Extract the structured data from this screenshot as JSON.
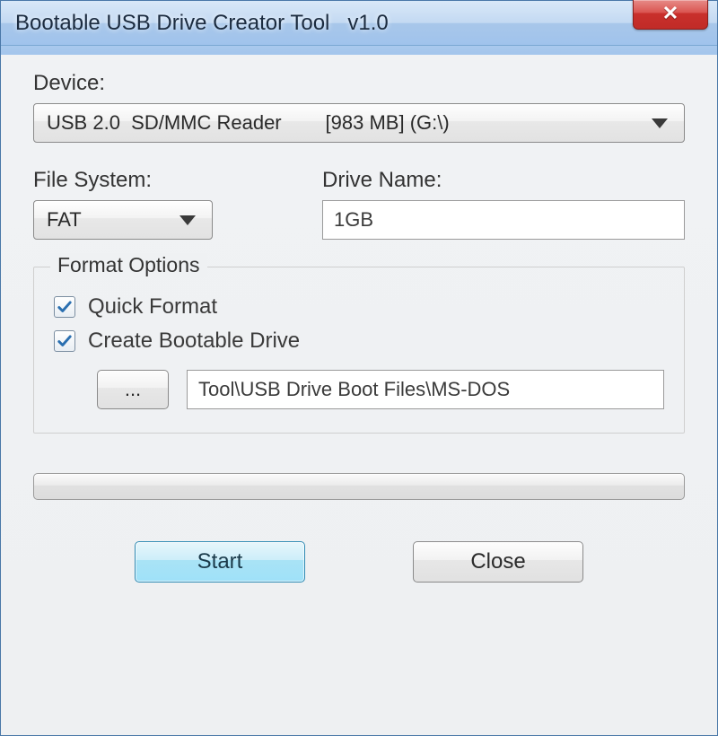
{
  "window": {
    "title": "Bootable USB Drive Creator Tool   v1.0"
  },
  "labels": {
    "device": "Device:",
    "file_system": "File System:",
    "drive_name": "Drive Name:",
    "format_options": "Format Options",
    "quick_format": "Quick Format",
    "create_bootable": "Create Bootable Drive"
  },
  "device": {
    "selected": "USB 2.0  SD/MMC Reader        [983 MB] (G:\\)"
  },
  "file_system": {
    "selected": "FAT"
  },
  "drive_name": {
    "value": "1GB"
  },
  "options": {
    "quick_format_checked": true,
    "create_bootable_checked": true,
    "browse_label": "...",
    "boot_path": "Tool\\USB Drive Boot Files\\MS-DOS"
  },
  "buttons": {
    "start": "Start",
    "close": "Close"
  }
}
